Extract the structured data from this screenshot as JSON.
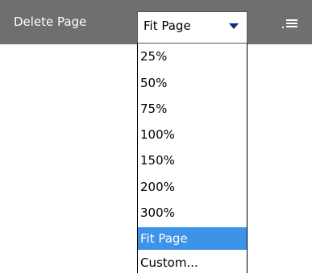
{
  "toolbar": {
    "delete_label": "Delete Page",
    "background": "#6f6f6f",
    "menu_icon": "list-menu-icon"
  },
  "zoom_select": {
    "value": "Fit Page",
    "caret_color": "#0b2c84"
  },
  "zoom_options": [
    "25%",
    "50%",
    "75%",
    "100%",
    "150%",
    "200%",
    "300%",
    "Fit Page",
    "Custom..."
  ],
  "selected_option": "Fit Page",
  "highlight_color": "#3c93e8"
}
